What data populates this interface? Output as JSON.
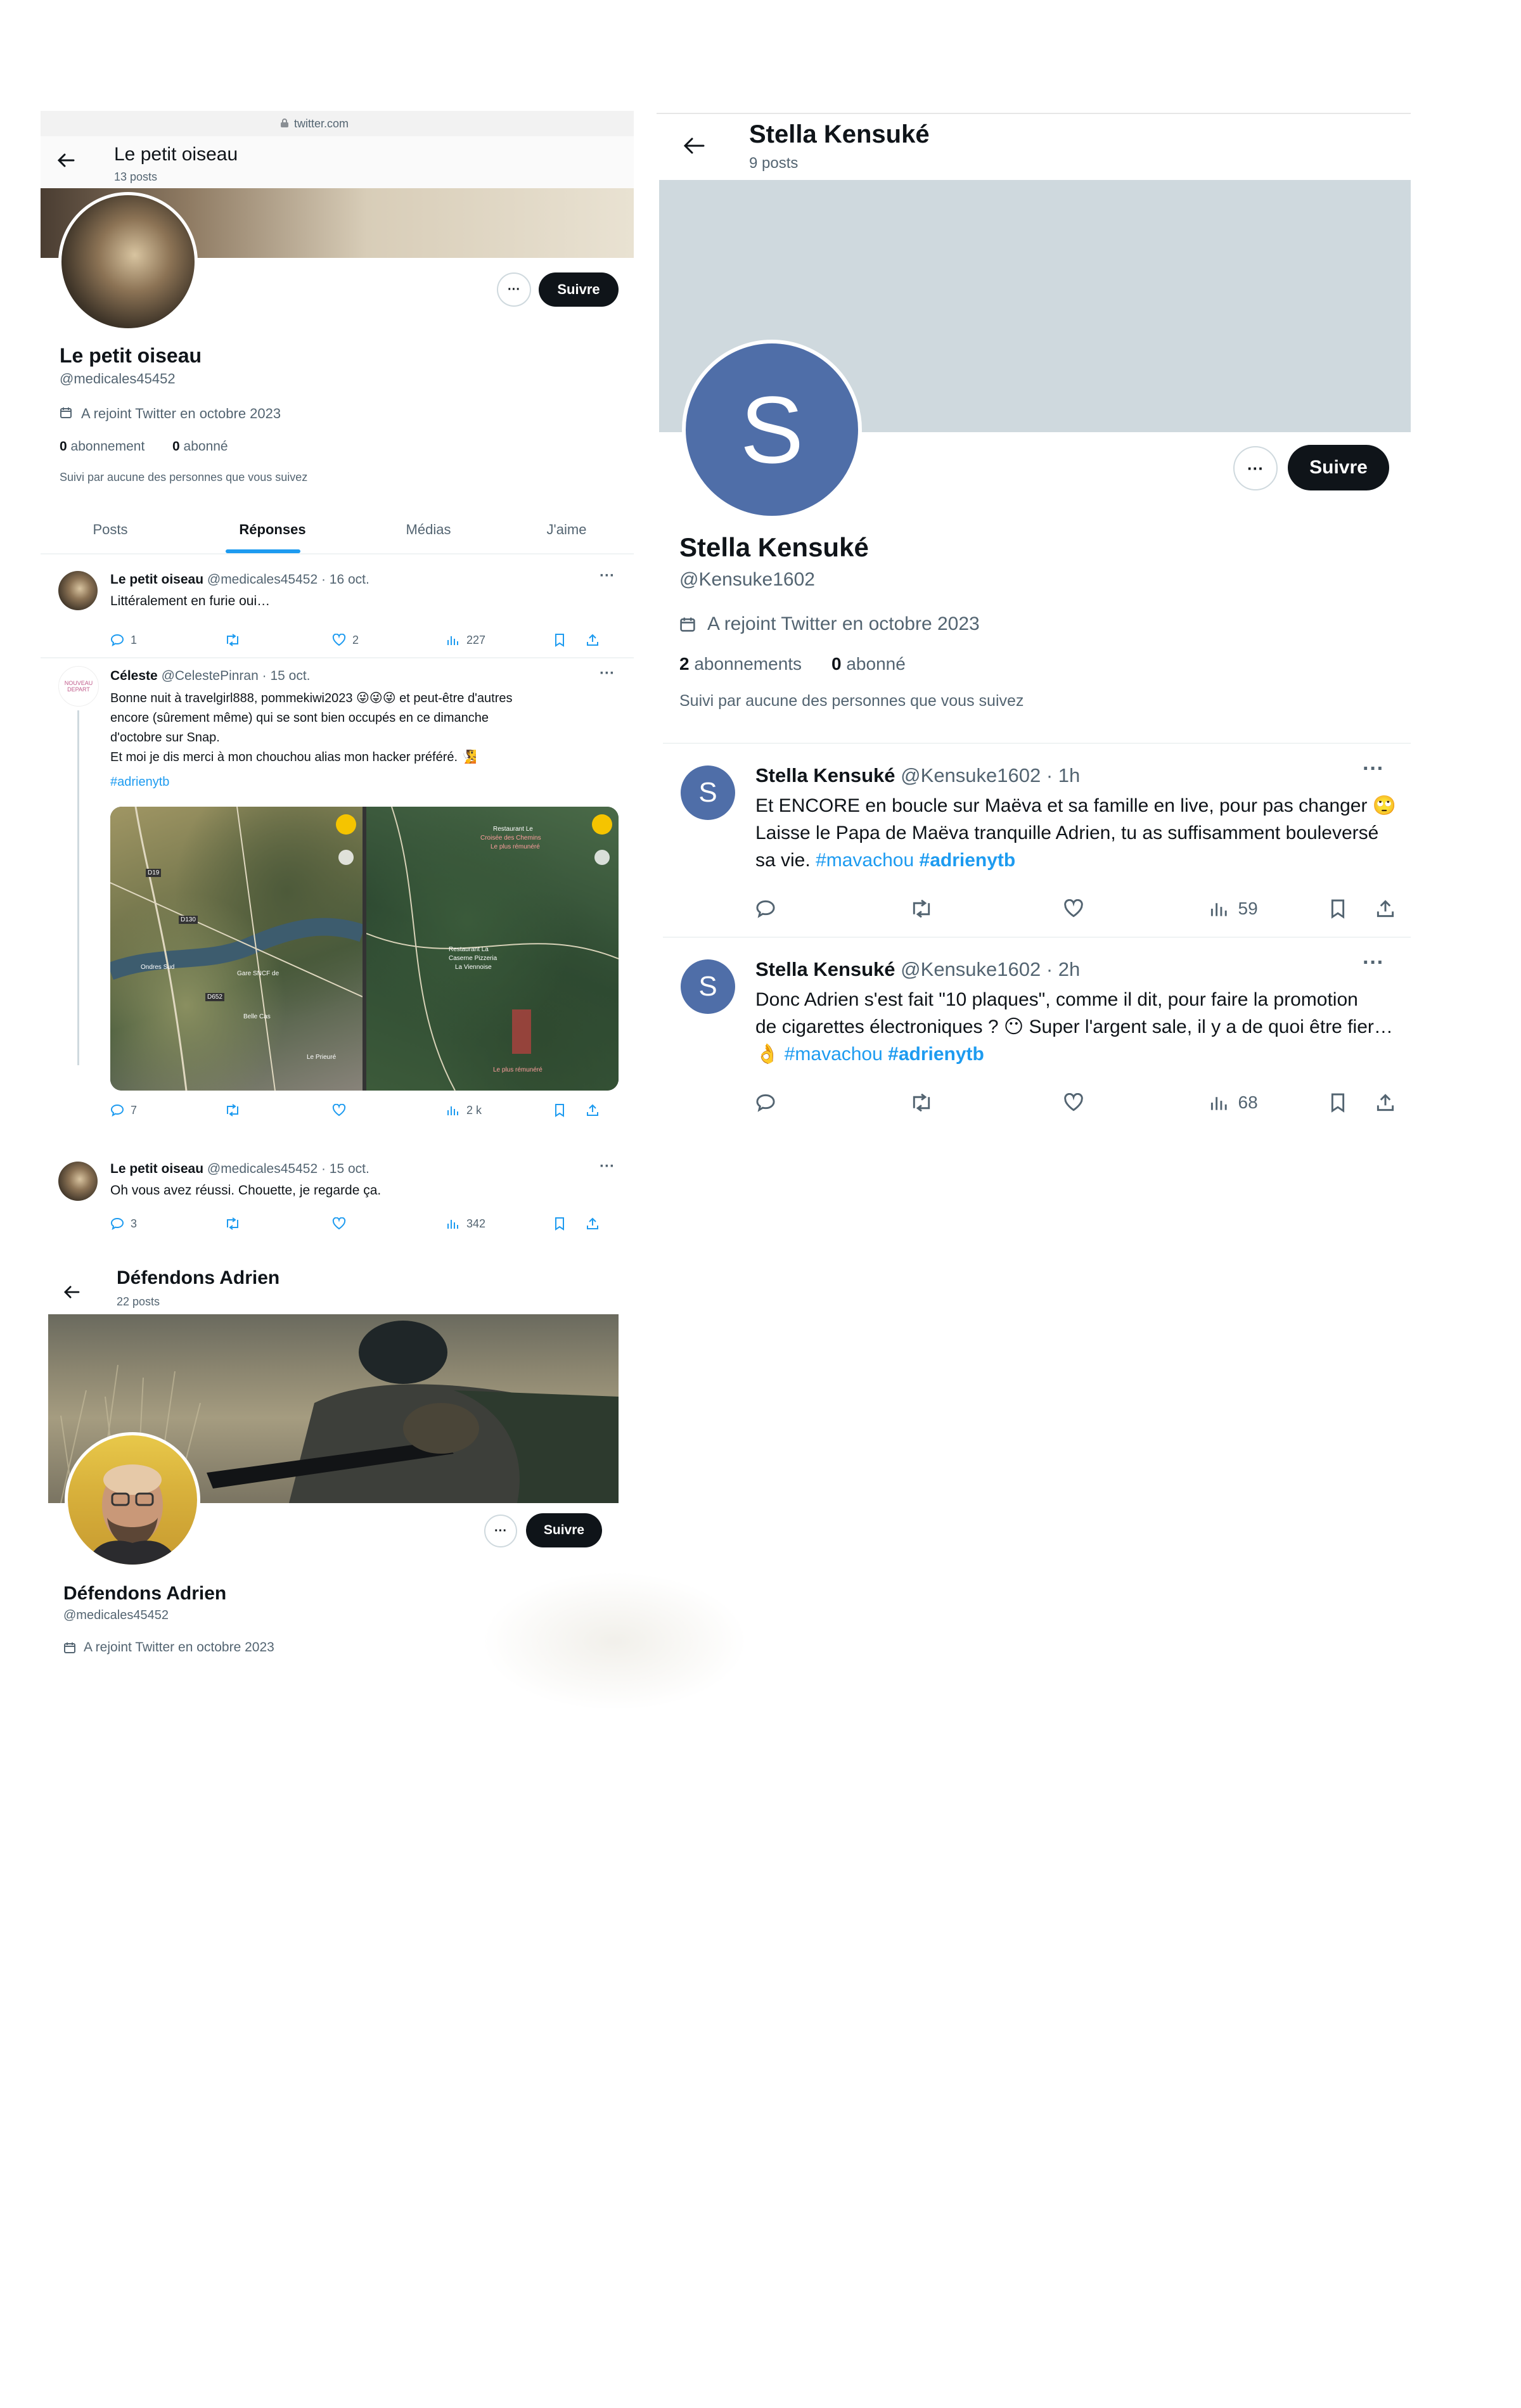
{
  "panel1": {
    "url": "twitter.com",
    "header_name": "Le petit oiseau",
    "header_posts": "13 posts",
    "follow_label": "Suivre",
    "more_label": "···",
    "name": "Le petit oiseau",
    "handle": "@medicales45452",
    "joined": "A rejoint Twitter en octobre 2023",
    "following_count": "0",
    "following_label": "abonnement",
    "followers_count": "0",
    "followers_label": "abonné",
    "followed_by": "Suivi par aucune des personnes que vous suivez",
    "tabs": [
      "Posts",
      "Réponses",
      "Médias",
      "J'aime"
    ],
    "active_tab": "Réponses",
    "tweets": [
      {
        "name": "Le petit oiseau",
        "meta": "@medicales45452 · 16 oct.",
        "text": "Littéralement en furie oui…",
        "replies": "1",
        "retweets": "",
        "likes": "2",
        "views": "227"
      },
      {
        "name": "Céleste",
        "meta": "@CelestePinran · 15 oct.",
        "avatar_label": "NOUVEAU DEPART",
        "text_lines": [
          "Bonne nuit à travelgirl888, pommekiwi2023 😜😜😜 et peut-être d'autres",
          "encore (sûrement même) qui se sont bien occupés en ce dimanche",
          "d'octobre sur Snap.",
          "Et moi je dis merci à mon chouchou alias mon hacker préféré. 🧏"
        ],
        "hashtag": "#adrienytb",
        "map_left_labels": [
          "D19",
          "D130",
          "Ondres Sud",
          "Gare SNCF de",
          "D652",
          "Belle Cas",
          "Le Prieuré"
        ],
        "map_right_labels": [
          "Restaurant Le",
          "Croisée des Chemins",
          "Le plus rémunéré",
          "Restaurant La",
          "Caserne Pizzeria",
          "La Viennoise",
          "Le plus rémunéré"
        ],
        "replies": "7",
        "retweets": "",
        "likes": "",
        "views": "2 k"
      },
      {
        "name": "Le petit oiseau",
        "meta": "@medicales45452 · 15 oct.",
        "text": "Oh vous avez réussi. Chouette, je regarde ça.",
        "replies": "3",
        "retweets": "",
        "likes": "",
        "views": "342"
      }
    ]
  },
  "panel2": {
    "header_name": "Stella Kensuké",
    "header_posts": "9 posts",
    "avatar_letter": "S",
    "follow_label": "Suivre",
    "more_label": "···",
    "name": "Stella Kensuké",
    "handle": "@Kensuke1602",
    "joined": "A rejoint Twitter en octobre 2023",
    "following_count": "2",
    "following_label": "abonnements",
    "followers_count": "0",
    "followers_label": "abonné",
    "followed_by": "Suivi par aucune des personnes que vous suivez",
    "banner_color": "#cfd9de",
    "avatar_color": "#4f6ea8",
    "tweets": [
      {
        "name": "Stella Kensuké",
        "meta": "@Kensuke1602 · 1h",
        "lines": [
          "Et ENCORE en boucle sur Maëva et sa famille en live, pour pas changer 🙄",
          "Laisse le Papa de Maëva tranquille Adrien, tu as suffisamment bouleversé",
          "sa vie."
        ],
        "hashtag1": "#mavachou",
        "hashtag2": "#adrienytb",
        "views": "59"
      },
      {
        "name": "Stella Kensuké",
        "meta": "@Kensuke1602 · 2h",
        "lines": [
          "Donc Adrien s'est fait \"10 plaques\",  comme il dit, pour faire la promotion",
          "de cigarettes électroniques ? 😶 Super l'argent sale, il y a de quoi être fier…",
          "👌"
        ],
        "hashtag1": "#mavachou",
        "hashtag2": "#adrienytb",
        "views": "68"
      }
    ]
  },
  "panel3": {
    "header_name": "Défendons Adrien",
    "header_posts": "22 posts",
    "follow_label": "Suivre",
    "more_label": "···",
    "name": "Défendons Adrien",
    "handle": "@medicales45452",
    "joined": "A rejoint Twitter en octobre 2023"
  }
}
